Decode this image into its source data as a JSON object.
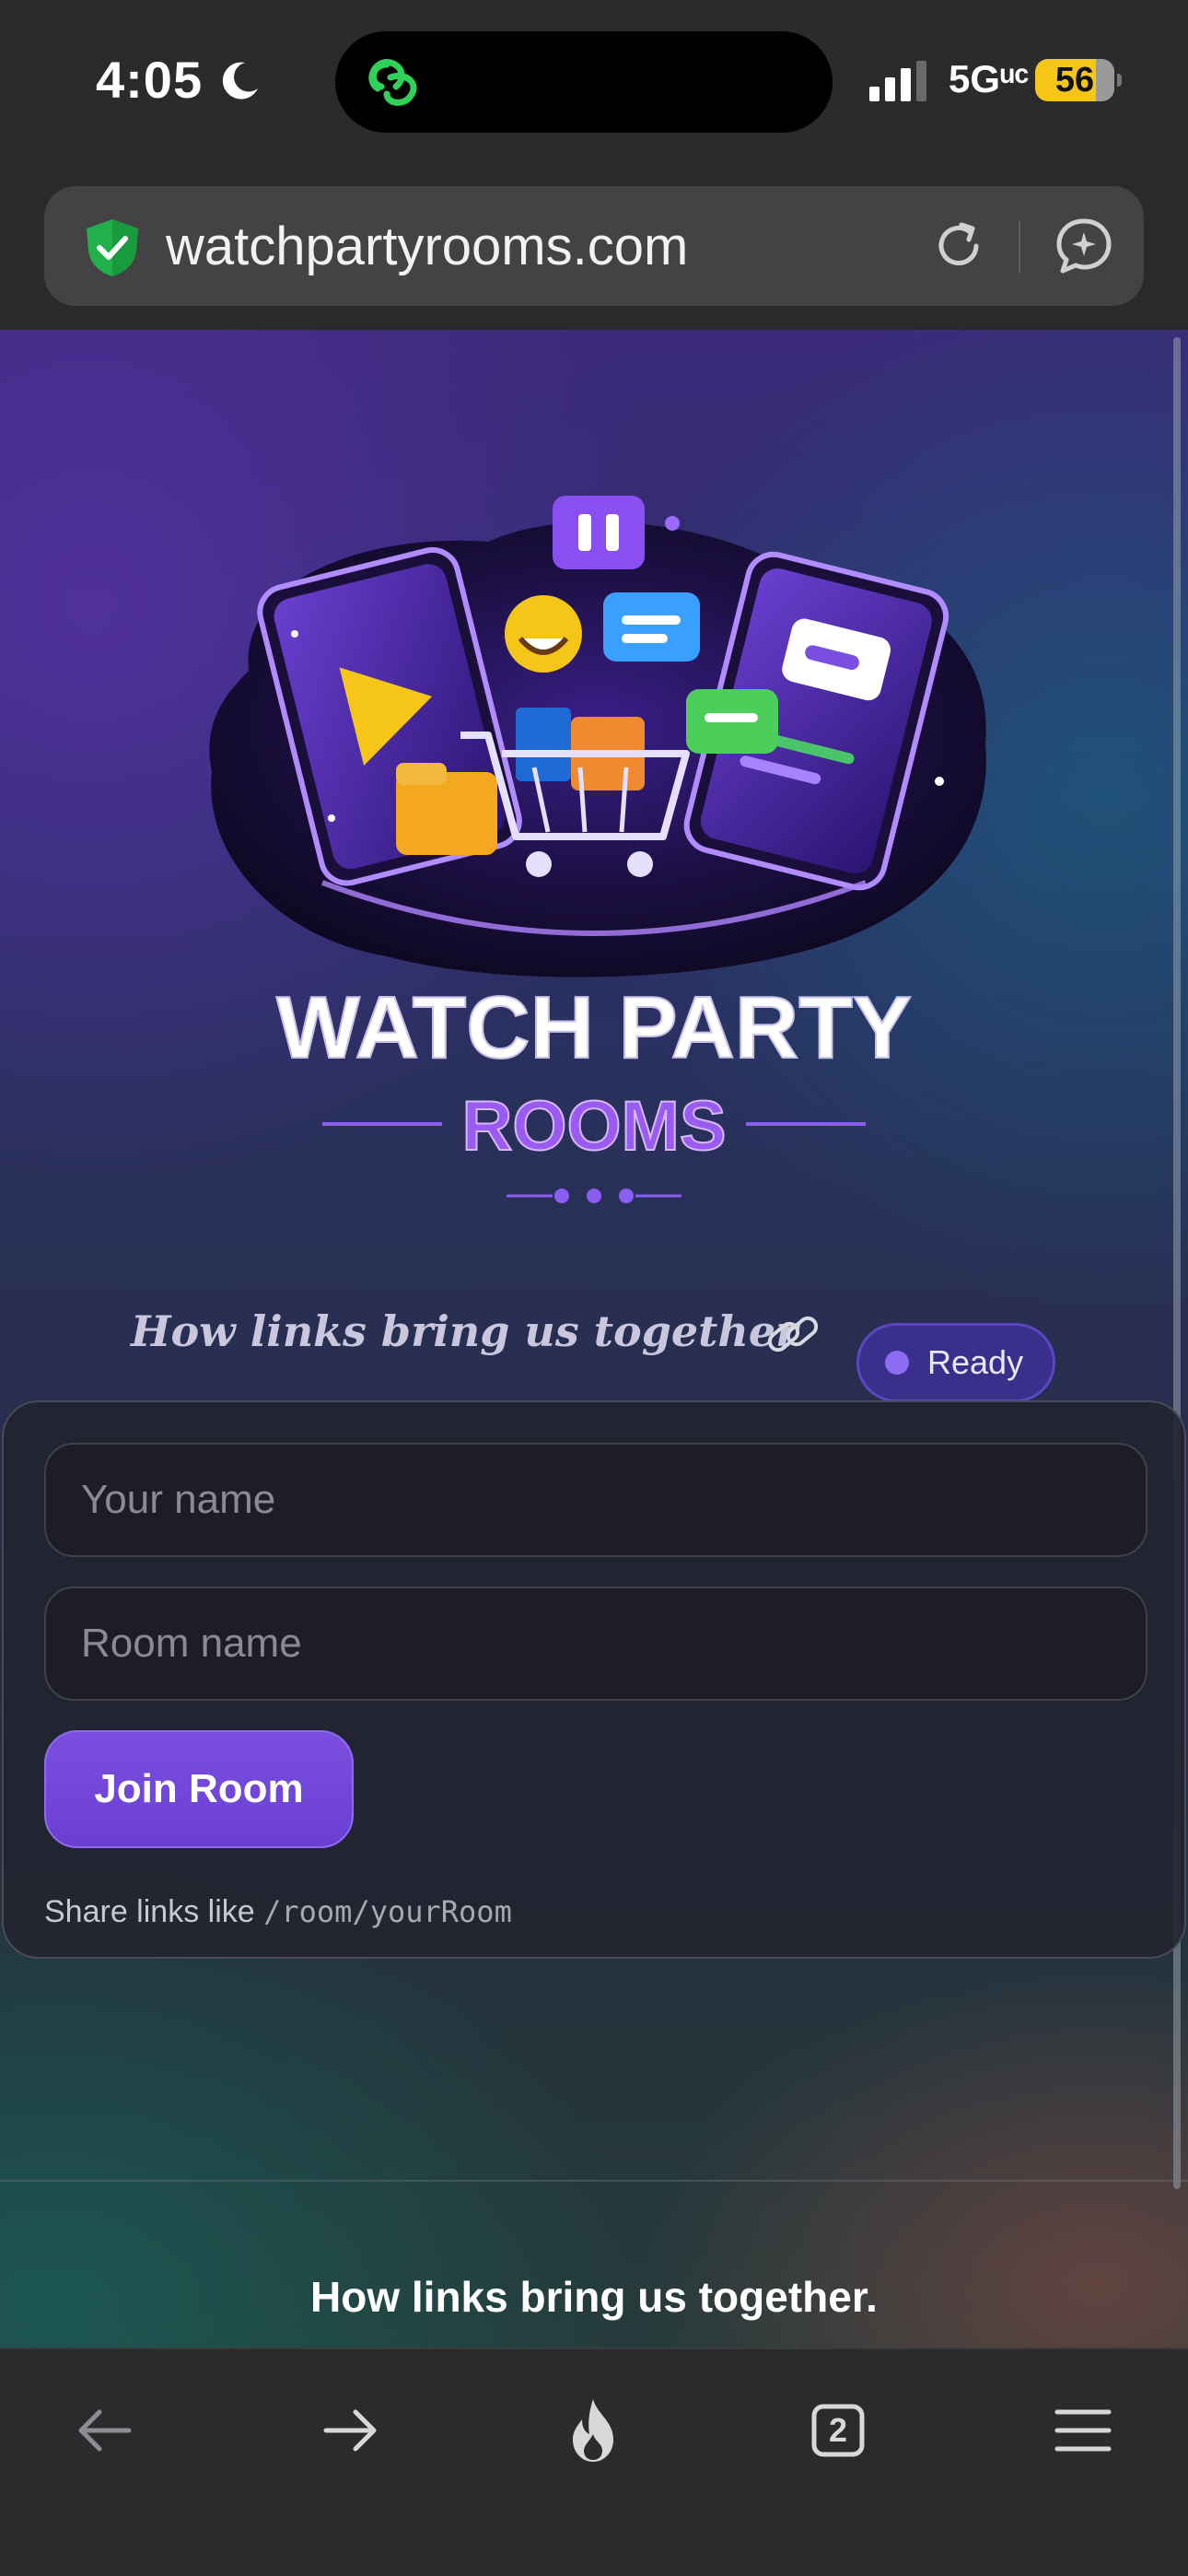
{
  "status_bar": {
    "time": "4:05",
    "network": "5Gᵘᶜ",
    "battery": "56"
  },
  "url_bar": {
    "url": "watchpartyrooms.com"
  },
  "logo": {
    "title_line1": "WATCH PARTY",
    "title_line2": "ROOMS"
  },
  "hero": {
    "tagline": "How links bring us together",
    "status_label": "Ready"
  },
  "form": {
    "name_placeholder": "Your name",
    "room_placeholder": "Room name",
    "join_label": "Join Room",
    "share_prefix": "Share links like",
    "share_example": "/room/yourRoom"
  },
  "footer": {
    "heading": "How links bring us together."
  },
  "toolbar": {
    "tab_count": "2"
  },
  "colors": {
    "accent": "#7048dc",
    "status_green": "#22c55e",
    "battery": "#f5c518"
  }
}
